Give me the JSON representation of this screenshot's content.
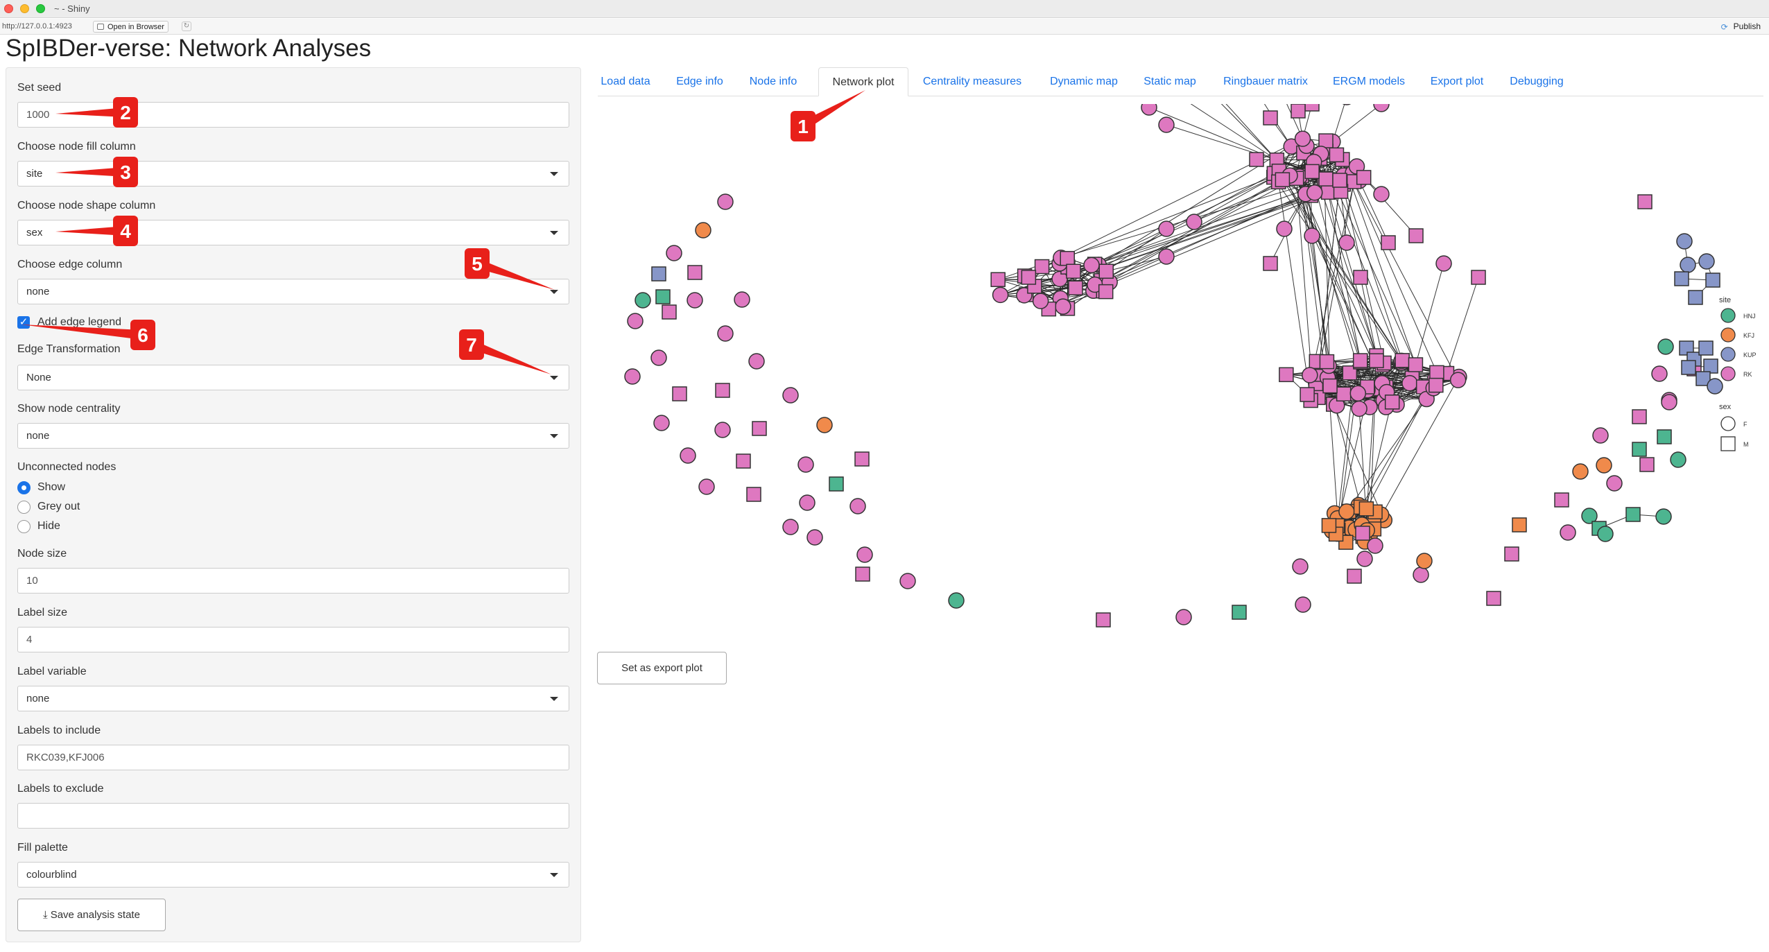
{
  "window": {
    "title": "~ - Shiny",
    "url": "http://127.0.0.1:4923",
    "open_in_browser": "Open in Browser",
    "publish": "Publish"
  },
  "app": {
    "title": "SpIBDer-verse: Network Analyses"
  },
  "sidebar": {
    "seed": {
      "label": "Set seed",
      "value": "1000"
    },
    "node_fill": {
      "label": "Choose node fill column",
      "value": "site"
    },
    "node_shape": {
      "label": "Choose node shape column",
      "value": "sex"
    },
    "edge_column": {
      "label": "Choose edge column",
      "value": "none"
    },
    "edge_legend": {
      "label": "Add edge legend",
      "checked": true
    },
    "edge_transform": {
      "label": "Edge Transformation",
      "value": "None"
    },
    "centrality": {
      "label": "Show node centrality",
      "value": "none"
    },
    "unconnected": {
      "label": "Unconnected nodes",
      "options": [
        "Show",
        "Grey out",
        "Hide"
      ],
      "selected": "Show"
    },
    "node_size": {
      "label": "Node size",
      "value": "10"
    },
    "label_size": {
      "label": "Label size",
      "value": "4"
    },
    "label_variable": {
      "label": "Label variable",
      "value": "none"
    },
    "labels_include": {
      "label": "Labels to include",
      "value": "RKC039,KFJ006"
    },
    "labels_exclude": {
      "label": "Labels to exclude",
      "value": ""
    },
    "fill_palette": {
      "label": "Fill palette",
      "value": "colourblind"
    },
    "save_button": "Save analysis state"
  },
  "tabs": [
    {
      "label": "Load data",
      "active": false
    },
    {
      "label": "Edge info",
      "active": false
    },
    {
      "label": "Node info",
      "active": false
    },
    {
      "label": "Network plot",
      "active": true
    },
    {
      "label": "Centrality measures",
      "active": false
    },
    {
      "label": "Dynamic map",
      "active": false
    },
    {
      "label": "Static map",
      "active": false
    },
    {
      "label": "Ringbauer matrix",
      "active": false
    },
    {
      "label": "ERGM models",
      "active": false
    },
    {
      "label": "Export plot",
      "active": false
    },
    {
      "label": "Debugging",
      "active": false
    }
  ],
  "plot": {
    "legend": {
      "fill_title": "site",
      "fill_items": [
        {
          "label": "HNJ",
          "color": "#4db590"
        },
        {
          "label": "KFJ",
          "color": "#f08a4b"
        },
        {
          "label": "KUP",
          "color": "#8796c8"
        },
        {
          "label": "RK",
          "color": "#de78c0"
        }
      ],
      "shape_title": "sex",
      "shape_items": [
        {
          "label": "F",
          "shape": "circle"
        },
        {
          "label": "M",
          "shape": "square"
        }
      ]
    }
  },
  "export_button": "Set as export plot",
  "callouts": [
    "1",
    "2",
    "3",
    "4",
    "5",
    "6",
    "7"
  ],
  "colors": {
    "accent": "#1a73e8",
    "callout": "#e8201a"
  }
}
